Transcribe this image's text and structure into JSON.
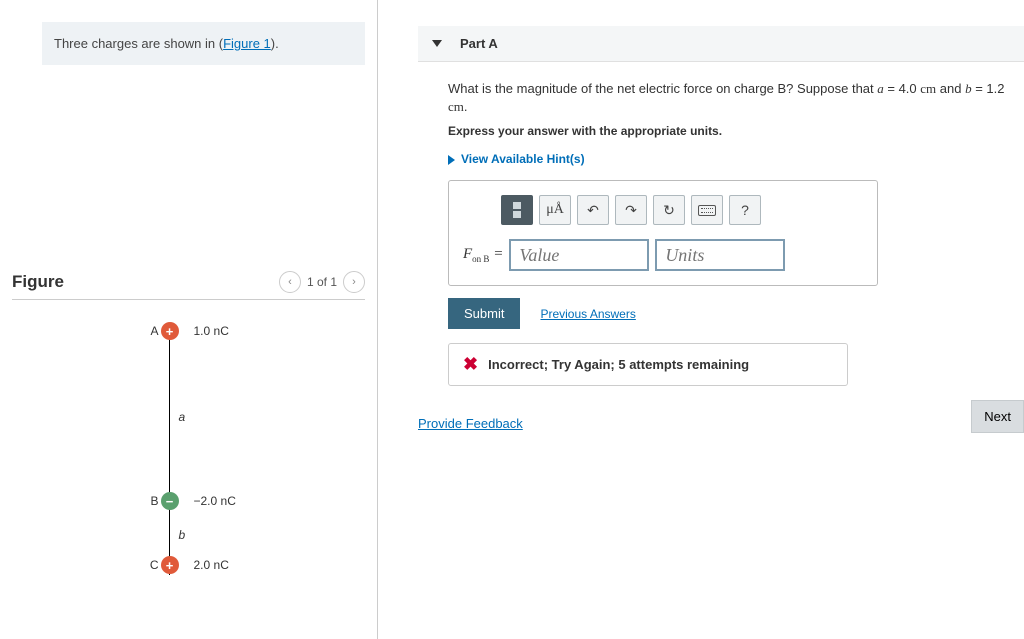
{
  "problem_statement": {
    "prefix": "Three charges are shown in (",
    "link_text": "Figure 1",
    "suffix": ")."
  },
  "figure": {
    "title": "Figure",
    "pager_text": "1 of 1",
    "charges": {
      "A": {
        "label": "A",
        "value": "1.0 nC"
      },
      "B": {
        "label": "B",
        "value": "−2.0 nC"
      },
      "C": {
        "label": "C",
        "value": "2.0 nC"
      }
    },
    "distance_a": "a",
    "distance_b": "b"
  },
  "part": {
    "header": "Part A",
    "question_1": "What is the magnitude of the net electric force on charge B? Suppose that ",
    "var_a": "a",
    "eq_a": " = 4.0 ",
    "unit_a": "cm",
    "and": " and ",
    "var_b": "b",
    "eq_b": " = 1.2 ",
    "unit_b": "cm",
    "period": ".",
    "instruction": "Express your answer with the appropriate units.",
    "hints_link": "View Available Hint(s)",
    "toolbar": {
      "special": "μÅ",
      "help": "?"
    },
    "answer_label_F": "F",
    "answer_label_sub": "on B",
    "answer_label_eq": " = ",
    "value_placeholder": "Value",
    "units_placeholder": "Units",
    "submit": "Submit",
    "previous_answers": "Previous Answers",
    "feedback": "Incorrect; Try Again; 5 attempts remaining"
  },
  "provide_feedback": "Provide Feedback",
  "next": "Next"
}
